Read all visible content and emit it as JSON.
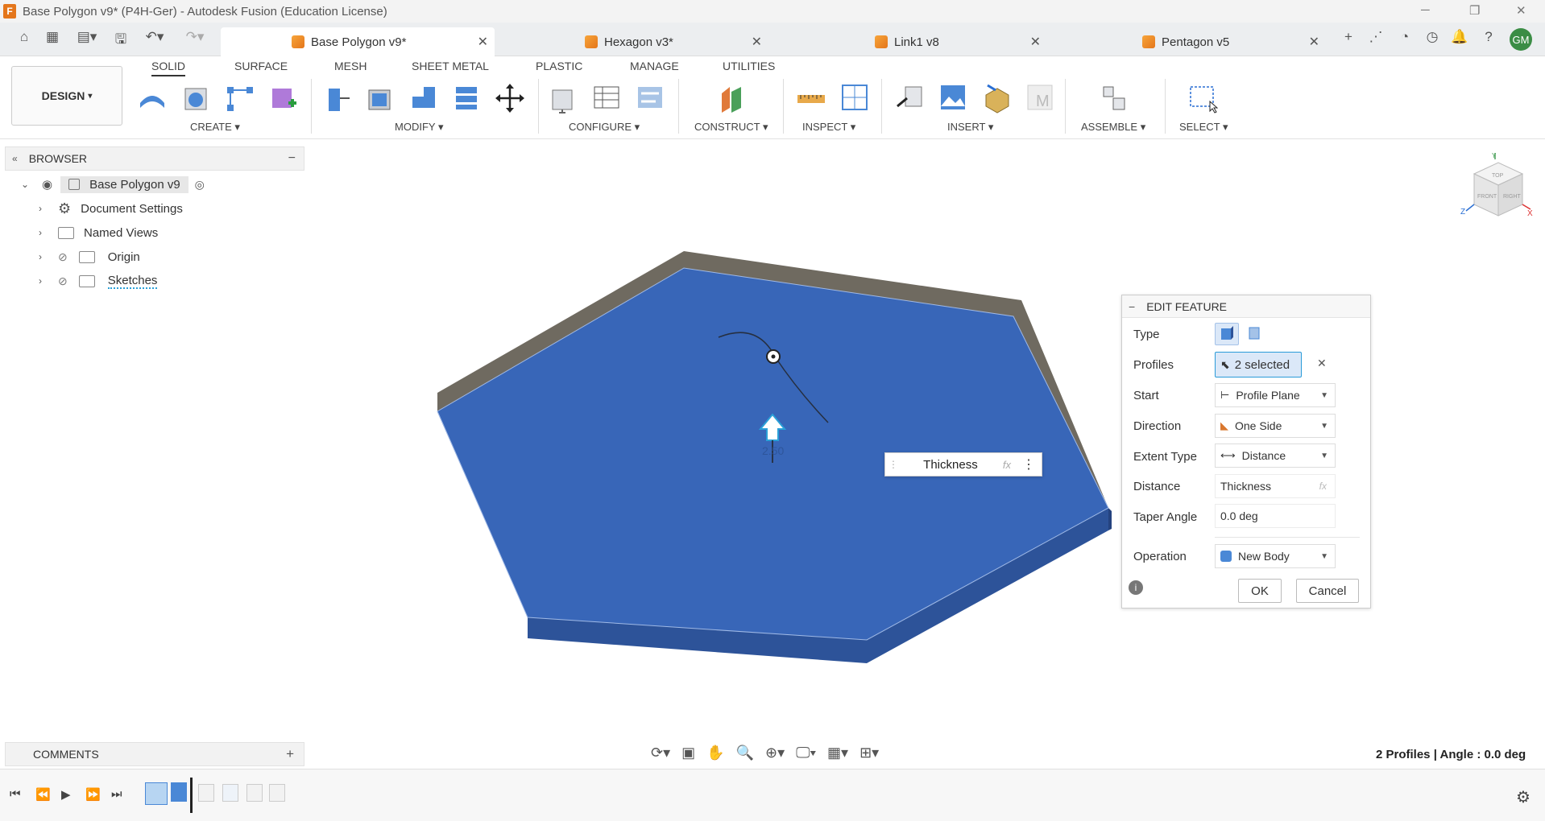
{
  "window": {
    "title": "Base Polygon v9* (P4H-Ger) - Autodesk Fusion (Education License)",
    "minimize_icon": "minimize-icon",
    "restore_icon": "restore-icon",
    "close_icon": "close-icon"
  },
  "doc_tabs": [
    {
      "label": "Base Polygon v9*",
      "active": true
    },
    {
      "label": "Hexagon v3*",
      "active": false
    },
    {
      "label": "Link1 v8",
      "active": false
    },
    {
      "label": "Pentagon v5",
      "active": false
    }
  ],
  "user_initials": "GM",
  "workspace": {
    "label": "DESIGN"
  },
  "ribbon_tabs": [
    "SOLID",
    "SURFACE",
    "MESH",
    "SHEET METAL",
    "PLASTIC",
    "MANAGE",
    "UTILITIES"
  ],
  "ribbon_groups": [
    "CREATE",
    "MODIFY",
    "CONFIGURE",
    "CONSTRUCT",
    "INSPECT",
    "INSERT",
    "ASSEMBLE",
    "SELECT"
  ],
  "browser": {
    "title": "BROWSER",
    "root": "Base Polygon v9",
    "items": [
      "Document Settings",
      "Named Views",
      "Origin",
      "Sketches"
    ]
  },
  "viewport": {
    "dimension_popup": {
      "label": "Thickness",
      "fx": "fx"
    },
    "manipulator_value": "2.50",
    "view_cube": {
      "top": "TOP",
      "front": "FRONT",
      "right": "RIGHT"
    }
  },
  "edit_feature": {
    "title": "EDIT FEATURE",
    "type_label": "Type",
    "profiles_label": "Profiles",
    "profiles_value": "2 selected",
    "start_label": "Start",
    "start_value": "Profile Plane",
    "direction_label": "Direction",
    "direction_value": "One Side",
    "extent_label": "Extent Type",
    "extent_value": "Distance",
    "distance_label": "Distance",
    "distance_value": "Thickness",
    "distance_fx": "fx",
    "taper_label": "Taper Angle",
    "taper_value": "0.0 deg",
    "operation_label": "Operation",
    "operation_value": "New Body",
    "ok": "OK",
    "cancel": "Cancel"
  },
  "comments": {
    "label": "COMMENTS"
  },
  "status": {
    "text": "2 Profiles | Angle : 0.0 deg"
  },
  "colors": {
    "body_blue": "#3866b8",
    "body_side": "#2d5399",
    "top_edge": "#6f6a60",
    "brand_orange": "#e4761b"
  }
}
